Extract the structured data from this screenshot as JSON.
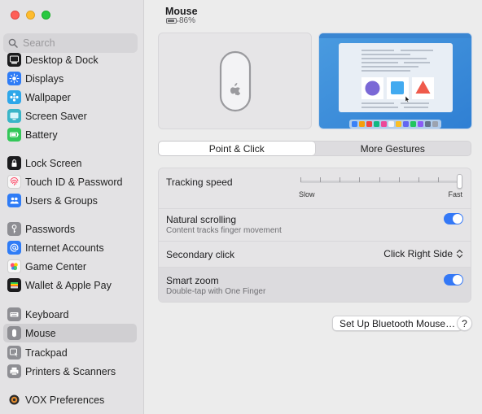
{
  "search": {
    "placeholder": "Search"
  },
  "sidebar": {
    "items": [
      {
        "label": "Desktop & Dock",
        "icon": "dock-icon",
        "color": "#1c1c1e"
      },
      {
        "label": "Displays",
        "icon": "display-icon",
        "color": "#2f7cf6"
      },
      {
        "label": "Wallpaper",
        "icon": "wallpaper-icon",
        "color": "#2ea7ea"
      },
      {
        "label": "Screen Saver",
        "icon": "screen-saver-icon",
        "color": "#3ab5c8"
      },
      {
        "label": "Battery",
        "icon": "battery-icon",
        "color": "#34c759"
      },
      {
        "label": "Lock Screen",
        "icon": "lock-icon",
        "color": "#1c1c1e"
      },
      {
        "label": "Touch ID & Password",
        "icon": "fingerprint-icon",
        "color": "#f7f7f7"
      },
      {
        "label": "Users & Groups",
        "icon": "users-icon",
        "color": "#2f7cf6"
      },
      {
        "label": "Passwords",
        "icon": "key-icon",
        "color": "#8e8e93"
      },
      {
        "label": "Internet Accounts",
        "icon": "at-icon",
        "color": "#2f7cf6"
      },
      {
        "label": "Game Center",
        "icon": "game-center-icon",
        "color": "#f7f7f7"
      },
      {
        "label": "Wallet & Apple Pay",
        "icon": "wallet-icon",
        "color": "#1c1c1e"
      },
      {
        "label": "Keyboard",
        "icon": "keyboard-icon",
        "color": "#8e8e93"
      },
      {
        "label": "Mouse",
        "icon": "mouse-icon",
        "color": "#8e8e93"
      },
      {
        "label": "Trackpad",
        "icon": "trackpad-icon",
        "color": "#8e8e93"
      },
      {
        "label": "Printers & Scanners",
        "icon": "printer-icon",
        "color": "#8e8e93"
      },
      {
        "label": "VOX Preferences",
        "icon": "vox-icon",
        "color": "#1c1c1e"
      }
    ],
    "selected": "Mouse"
  },
  "header": {
    "title": "Mouse",
    "battery": "86%",
    "battery_level": 0.86
  },
  "tabs": [
    {
      "label": "Point & Click",
      "active": true
    },
    {
      "label": "More Gestures",
      "active": false
    }
  ],
  "settings": {
    "tracking": {
      "label": "Tracking speed",
      "min_label": "Slow",
      "max_label": "Fast",
      "value": 1.0
    },
    "natural_scrolling": {
      "label": "Natural scrolling",
      "sub": "Content tracks finger movement",
      "on": true
    },
    "secondary_click": {
      "label": "Secondary click",
      "value": "Click Right Side"
    },
    "smart_zoom": {
      "label": "Smart zoom",
      "sub": "Double-tap with One Finger",
      "on": true
    }
  },
  "buttons": {
    "bluetooth": "Set Up Bluetooth Mouse…",
    "help": "?"
  },
  "colors": {
    "accent": "#3478f6"
  }
}
